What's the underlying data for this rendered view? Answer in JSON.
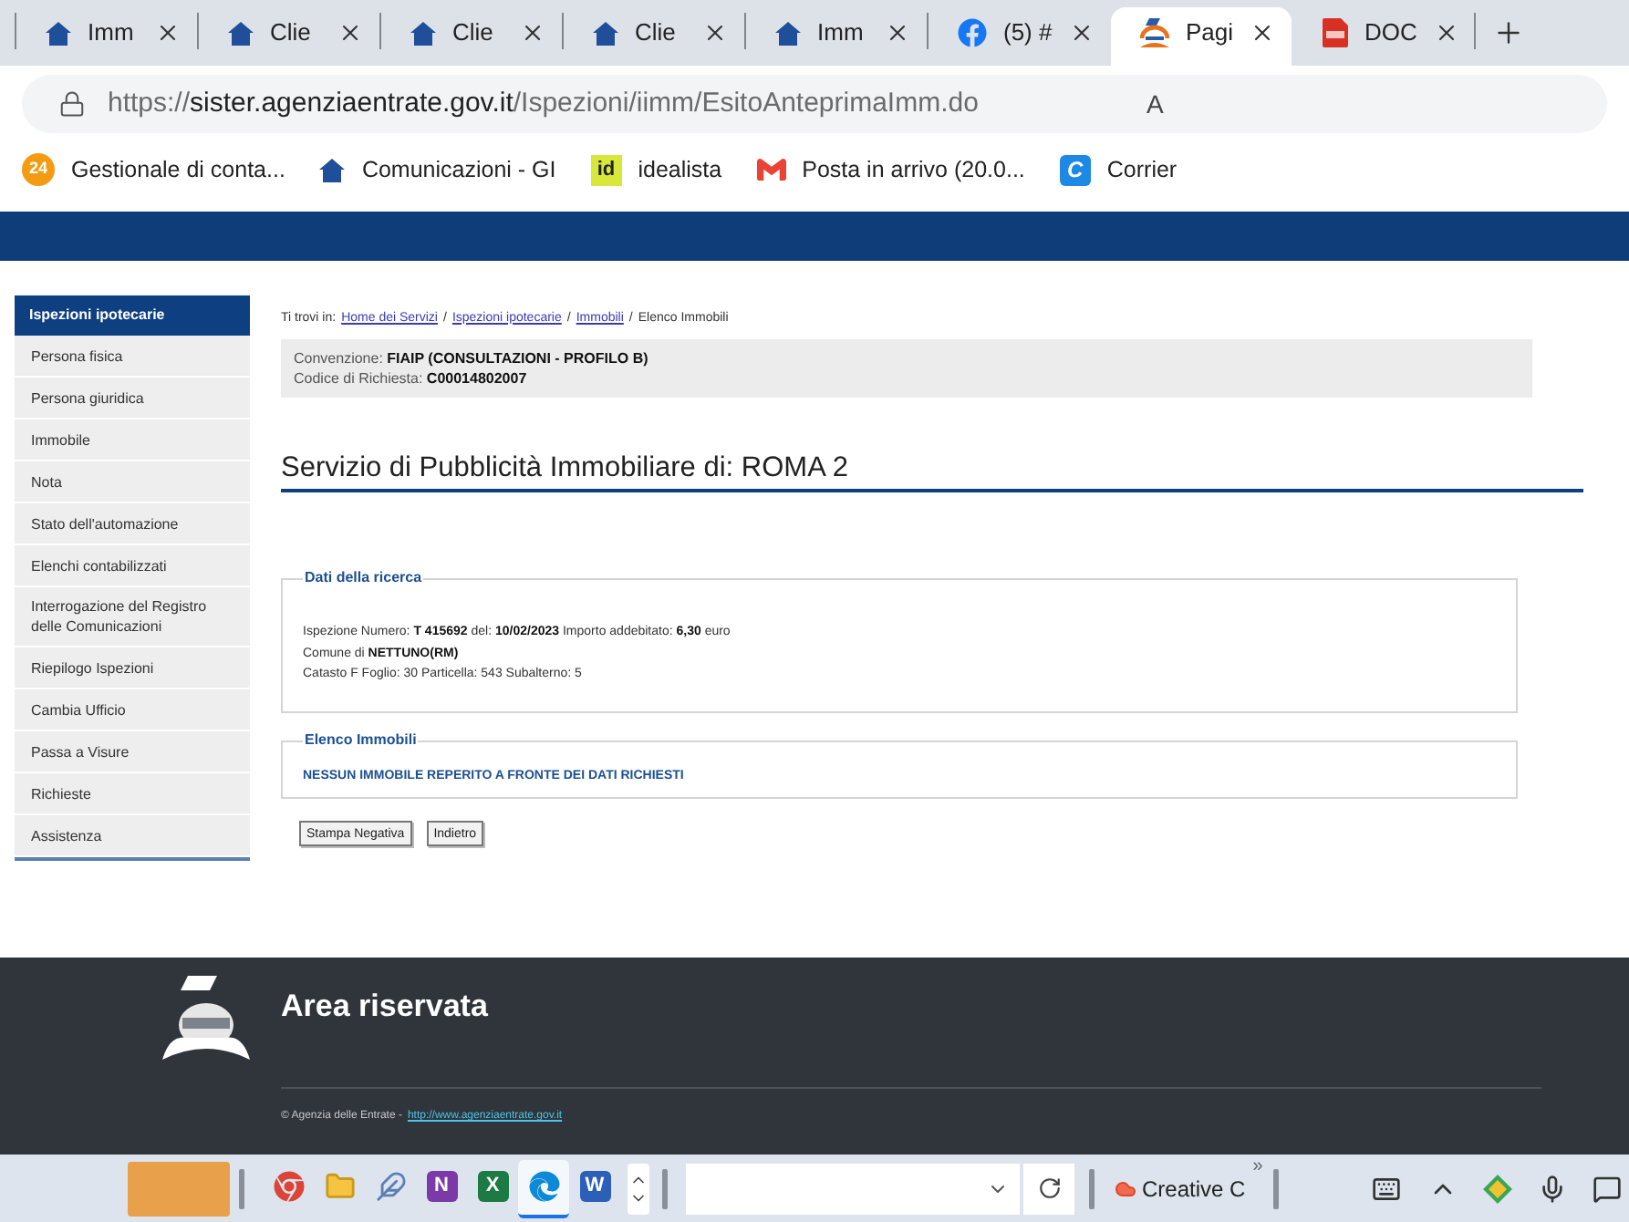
{
  "browser": {
    "tabs": [
      {
        "title": "Imm",
        "kind": "house",
        "selected": false
      },
      {
        "title": "Clie",
        "kind": "house",
        "selected": false
      },
      {
        "title": "Clie",
        "kind": "house",
        "selected": false
      },
      {
        "title": "Clie",
        "kind": "house",
        "selected": false
      },
      {
        "title": "Imm",
        "kind": "house",
        "selected": false
      },
      {
        "title": "(5) #",
        "kind": "facebook",
        "selected": false
      },
      {
        "title": "Pagi",
        "kind": "agency",
        "selected": true
      },
      {
        "title": "DOC",
        "kind": "pdf",
        "selected": false
      }
    ],
    "address": {
      "scheme": "https://",
      "host": "sister.agenziaentrate.gov.it",
      "path": "/Ispezioni/iimm/EsitoAnteprimaImm.do",
      "reader_glyph": "A"
    },
    "bookmarks": [
      {
        "label": "Gestionale di conta...",
        "kind": "number",
        "glyph": "24"
      },
      {
        "label": "Comunicazioni - GI",
        "kind": "house"
      },
      {
        "label": "idealista",
        "kind": "tile",
        "glyph": "id"
      },
      {
        "label": "Posta in arrivo (20.0...",
        "kind": "gmail"
      },
      {
        "label": "Corrier",
        "kind": "letter",
        "glyph": "C"
      }
    ]
  },
  "sidebar": {
    "heading": "Ispezioni ipotecarie",
    "items": [
      "Persona fisica",
      "Persona giuridica",
      "Immobile",
      "Nota",
      "Stato dell'automazione",
      "Elenchi contabilizzati",
      "Interrogazione del Registro delle Comunicazioni",
      "Riepilogo Ispezioni",
      "Cambia Ufficio",
      "Passa a Visure",
      "Richieste",
      "Assistenza"
    ]
  },
  "breadcrumb": [
    {
      "kind": "label",
      "text": "Ti trovi in:"
    },
    {
      "kind": "link",
      "text": "Home dei Servizi"
    },
    {
      "kind": "separator",
      "text": "/"
    },
    {
      "kind": "link",
      "text": "Ispezioni ipotecarie"
    },
    {
      "kind": "separator",
      "text": "/"
    },
    {
      "kind": "link",
      "text": "Immobili"
    },
    {
      "kind": "separator",
      "text": "/"
    },
    {
      "kind": "current",
      "text": "Elenco Immobili"
    }
  ],
  "request_info": [
    "Convenzione: **FIAIP (CONSULTAZIONI - PROFILO B)**",
    "Codice di Richiesta: **C00014802007**"
  ],
  "title": "Servizio di Pubblicità Immobiliare di: ROMA 2",
  "search_data": {
    "legend": "Dati della ricerca",
    "lines": [
      "Ispezione Numero: **T 415692** del: **10/02/2023** Importo addebitato: **6,30** euro",
      "Comune di **NETTUNO(RM)**",
      "Catasto F Foglio: 30 Particella: 543 Subalterno: 5"
    ]
  },
  "property_list": {
    "legend": "Elenco Immobili",
    "message": "NESSUN IMMOBILE REPERITO A FRONTE DEI DATI RICHIESTI"
  },
  "buttons": [
    "Stampa Negativa",
    "Indietro"
  ],
  "footer": {
    "title": "Area riservata",
    "copyright": "© Agenzia delle Entrate -",
    "link": "http://www.agenziaentrate.gov.it"
  },
  "taskbar": {
    "apps": [
      {
        "kind": "chrome",
        "selected": false
      },
      {
        "kind": "folder",
        "selected": false
      },
      {
        "kind": "feather",
        "selected": false
      },
      {
        "kind": "onenote",
        "glyph": "N",
        "selected": false
      },
      {
        "kind": "excel",
        "glyph": "X",
        "selected": false
      },
      {
        "kind": "edge",
        "selected": true
      },
      {
        "kind": "word",
        "glyph": "W",
        "selected": false
      }
    ],
    "window_button": {
      "label": "Creative C"
    },
    "overflow": "»"
  }
}
